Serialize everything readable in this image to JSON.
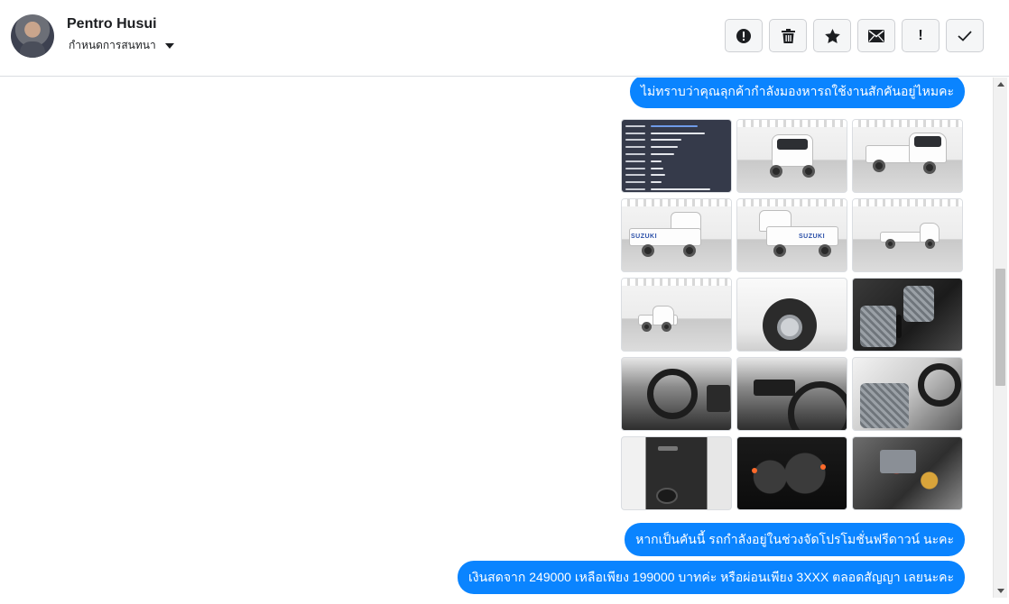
{
  "header": {
    "user_name": "Pentro Husui",
    "status_label": "กำหนดการสนทนา",
    "actions": [
      {
        "icon": "alert-circle-icon",
        "label": "report"
      },
      {
        "icon": "trash-icon",
        "label": "delete"
      },
      {
        "icon": "star-icon",
        "label": "favorite"
      },
      {
        "icon": "mail-icon",
        "label": "mark unread"
      },
      {
        "icon": "exclamation-icon",
        "label": "important",
        "glyph": "!"
      },
      {
        "icon": "check-icon",
        "label": "done"
      }
    ]
  },
  "messages": [
    {
      "text": "ไม่ทราบว่าคุณลุกค้ากำลังมองหารถใช้งานสักคันอยู่ไหมคะ"
    },
    {
      "text": "หากเป็นคันนี้ รถกำลังอยู่ในช่วงจัดโปรโมชั่นฟรีดาวน์ นะคะ"
    },
    {
      "text": "เงินสดจาก 249000 เหลือเพียง 199000 บาทค่ะ หรือผ่อนเพียง 3XXX ตลอดสัญญา เลยนะคะ"
    }
  ],
  "photos": [
    {
      "kind": "info-card"
    },
    {
      "kind": "truck-front"
    },
    {
      "kind": "truck-front-quarter"
    },
    {
      "kind": "truck-rear-quarter",
      "badge": "SUZUKI"
    },
    {
      "kind": "truck-rear-quarter-2",
      "badge": "SUZUKI"
    },
    {
      "kind": "truck-side"
    },
    {
      "kind": "truck-side-2"
    },
    {
      "kind": "truck-wheel"
    },
    {
      "kind": "interior-seats"
    },
    {
      "kind": "interior-dashboard"
    },
    {
      "kind": "interior-steering"
    },
    {
      "kind": "interior-seat-steering"
    },
    {
      "kind": "door-panel"
    },
    {
      "kind": "gauge-cluster"
    },
    {
      "kind": "engine-bay"
    }
  ],
  "colors": {
    "bubble": "#0a84ff",
    "bubble_text": "#ffffff",
    "border": "#dadde1"
  }
}
